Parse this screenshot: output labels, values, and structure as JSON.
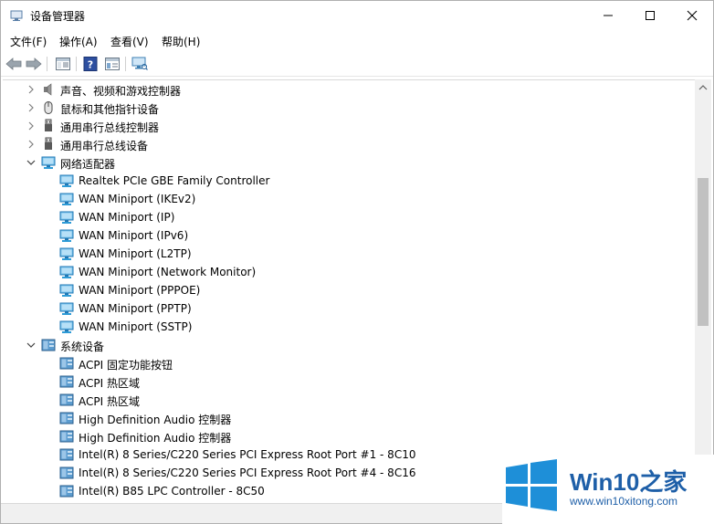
{
  "window": {
    "title": "设备管理器"
  },
  "menu": [
    {
      "label": "文件(F)"
    },
    {
      "label": "操作(A)"
    },
    {
      "label": "查看(V)"
    },
    {
      "label": "帮助(H)"
    }
  ],
  "tree": [
    {
      "label": "声音、视频和游戏控制器",
      "level": 0,
      "state": "collapsed",
      "icon": "speaker-icon"
    },
    {
      "label": "鼠标和其他指针设备",
      "level": 0,
      "state": "collapsed",
      "icon": "mouse-icon"
    },
    {
      "label": "通用串行总线控制器",
      "level": 0,
      "state": "collapsed",
      "icon": "usb-icon"
    },
    {
      "label": "通用串行总线设备",
      "level": 0,
      "state": "collapsed",
      "icon": "usb-icon"
    },
    {
      "label": "网络适配器",
      "level": 0,
      "state": "expanded",
      "icon": "network-adapter-icon"
    },
    {
      "label": "Realtek PCIe GBE Family Controller",
      "level": 1,
      "icon": "network-adapter-icon"
    },
    {
      "label": "WAN Miniport (IKEv2)",
      "level": 1,
      "icon": "network-adapter-icon"
    },
    {
      "label": "WAN Miniport (IP)",
      "level": 1,
      "icon": "network-adapter-icon"
    },
    {
      "label": "WAN Miniport (IPv6)",
      "level": 1,
      "icon": "network-adapter-icon"
    },
    {
      "label": "WAN Miniport (L2TP)",
      "level": 1,
      "icon": "network-adapter-icon"
    },
    {
      "label": "WAN Miniport (Network Monitor)",
      "level": 1,
      "icon": "network-adapter-icon"
    },
    {
      "label": "WAN Miniport (PPPOE)",
      "level": 1,
      "icon": "network-adapter-icon"
    },
    {
      "label": "WAN Miniport (PPTP)",
      "level": 1,
      "icon": "network-adapter-icon"
    },
    {
      "label": "WAN Miniport (SSTP)",
      "level": 1,
      "icon": "network-adapter-icon"
    },
    {
      "label": "系统设备",
      "level": 0,
      "state": "expanded",
      "icon": "system-device-icon"
    },
    {
      "label": "ACPI 固定功能按钮",
      "level": 1,
      "icon": "system-device-icon"
    },
    {
      "label": "ACPI 热区域",
      "level": 1,
      "icon": "system-device-icon"
    },
    {
      "label": "ACPI 热区域",
      "level": 1,
      "icon": "system-device-icon"
    },
    {
      "label": "High Definition Audio 控制器",
      "level": 1,
      "icon": "system-device-icon"
    },
    {
      "label": "High Definition Audio 控制器",
      "level": 1,
      "icon": "system-device-icon"
    },
    {
      "label": "Intel(R) 8 Series/C220 Series PCI Express Root Port #1 - 8C10",
      "level": 1,
      "icon": "system-device-icon"
    },
    {
      "label": "Intel(R) 8 Series/C220 Series PCI Express Root Port #4 - 8C16",
      "level": 1,
      "icon": "system-device-icon"
    },
    {
      "label": "Intel(R) B85 LPC Controller - 8C50",
      "level": 1,
      "icon": "system-device-icon"
    }
  ],
  "watermark": {
    "title_main": "Win10",
    "title_accent": "之家",
    "url": "www.win10xitong.com"
  },
  "colors": {
    "accent": "#1e5fa8",
    "network_icon": "#2e9bd6",
    "system_icon": "#3d7fb3"
  }
}
